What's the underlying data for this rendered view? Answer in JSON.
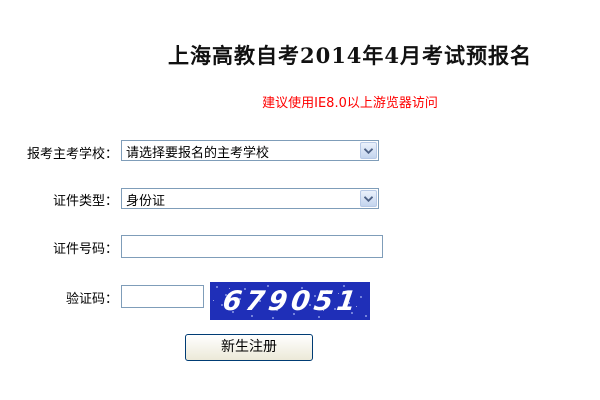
{
  "header": {
    "title": "上海高教自考2014年4月考试预报名",
    "notice": "建议使用IE8.0以上游览器访问"
  },
  "form": {
    "school_label": "报考主考学校：",
    "school_selected": "请选择要报名的主考学校",
    "idtype_label": "证件类型：",
    "idtype_selected": "身份证",
    "idnum_label": "证件号码：",
    "idnum_value": "",
    "captcha_label": "验证码：",
    "captcha_value": "",
    "captcha_image_text": "679051",
    "submit_label": "新生注册"
  },
  "colors": {
    "notice": "#ff0000",
    "captcha_bg": "#1f2fb8",
    "captcha_text": "#ffffff"
  },
  "icons": {
    "dropdown": "chevron-down-icon"
  }
}
